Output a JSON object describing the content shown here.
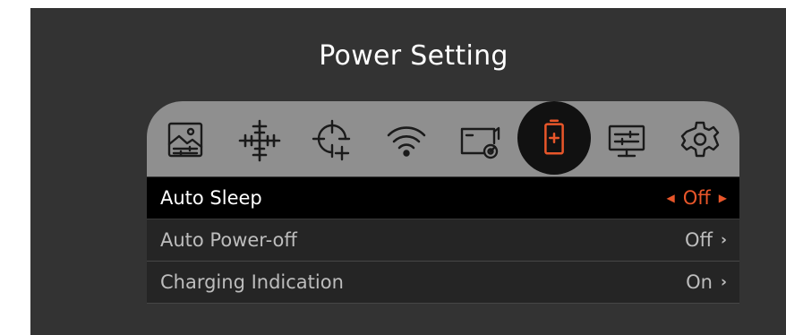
{
  "title": "Power Setting",
  "colors": {
    "accent": "#e8562a",
    "icon_stroke": "#1a1a1a",
    "screen_bg": "#333333"
  },
  "icons": [
    "image-settings-icon",
    "crosshair-icon",
    "target-add-icon",
    "wifi-icon",
    "video-record-icon",
    "battery-icon",
    "display-settings-icon",
    "gear-icon"
  ],
  "active_icon": "battery-icon",
  "rows": [
    {
      "label": "Auto Sleep",
      "value": "Off",
      "selected": true
    },
    {
      "label": "Auto Power-off",
      "value": "Off",
      "selected": false
    },
    {
      "label": "Charging Indication",
      "value": "On",
      "selected": false
    }
  ]
}
